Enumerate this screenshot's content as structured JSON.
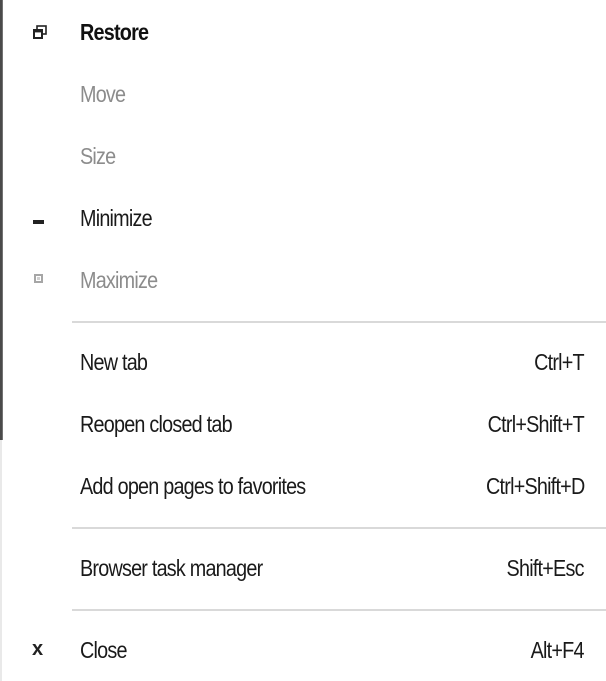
{
  "context_menu": {
    "items": [
      {
        "label": "Restore",
        "shortcut": "",
        "icon": "restore-icon",
        "enabled": true,
        "bold": true
      },
      {
        "label": "Move",
        "shortcut": "",
        "icon": "",
        "enabled": false
      },
      {
        "label": "Size",
        "shortcut": "",
        "icon": "",
        "enabled": false
      },
      {
        "label": "Minimize",
        "shortcut": "",
        "icon": "minimize-icon",
        "enabled": true
      },
      {
        "label": "Maximize",
        "shortcut": "",
        "icon": "maximize-icon",
        "enabled": false
      },
      {
        "label": "New tab",
        "shortcut": "Ctrl+T",
        "icon": "",
        "enabled": true
      },
      {
        "label": "Reopen closed tab",
        "shortcut": "Ctrl+Shift+T",
        "icon": "",
        "enabled": true
      },
      {
        "label": "Add open pages to favorites",
        "shortcut": "Ctrl+Shift+D",
        "icon": "",
        "enabled": true
      },
      {
        "label": "Browser task manager",
        "shortcut": "Shift+Esc",
        "icon": "",
        "enabled": true
      },
      {
        "label": "Close",
        "shortcut": "Alt+F4",
        "icon": "close-icon",
        "enabled": true
      }
    ],
    "close_glyph": "x"
  },
  "colors": {
    "text": "#1a1a1a",
    "disabled_text": "#8c8c8c",
    "separator": "#d9d9d9",
    "background": "#ffffff"
  }
}
